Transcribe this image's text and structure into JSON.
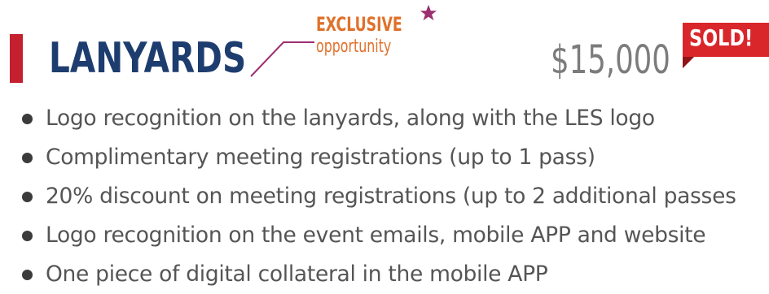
{
  "header": {
    "title": "LANYARDS",
    "badge_line1": "EXCLUSIVE",
    "badge_line2": "opportunity",
    "price": "$15,000",
    "status": "SOLD!"
  },
  "benefits": [
    "Logo recognition on the lanyards, along with the LES logo",
    "Complimentary meeting registrations (up to 1 pass)",
    "20% discount on meeting registrations (up to 2 additional passes",
    "Logo recognition on the event emails, mobile APP and website",
    "One piece of digital collateral in the mobile APP"
  ],
  "colors": {
    "title": "#1e3d6f",
    "accent": "#c4202f",
    "badge": "#e0712b",
    "star": "#9c2f70",
    "price": "#7c7c7c",
    "sold": "#d9262b"
  },
  "icons": {
    "star": "star-icon",
    "bullet": "bullet-dot"
  }
}
